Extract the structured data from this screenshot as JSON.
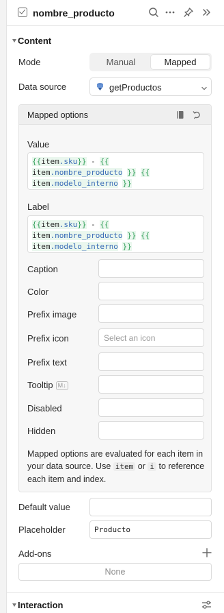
{
  "header": {
    "title": "nombre_producto",
    "icons": [
      "checkbox-icon",
      "search-icon",
      "more-icon",
      "pin-icon",
      "collapse-icon"
    ]
  },
  "content_section": {
    "title": "Content",
    "mode": {
      "label": "Mode",
      "options": [
        "Manual",
        "Mapped"
      ],
      "selected": "Mapped"
    },
    "data_source": {
      "label": "Data source",
      "value": "getProductos"
    },
    "mapped_options": {
      "title": "Mapped options",
      "value": {
        "label": "Value"
      },
      "label": {
        "label": "Label"
      },
      "code": {
        "open": "{{",
        "close": "}}",
        "sep": " - ",
        "item": "item",
        "sku": ".sku",
        "nombre": ".nombre_producto",
        "modelo": ".modelo_interno"
      },
      "fields": {
        "caption": "Caption",
        "color": "Color",
        "prefix_image": "Prefix image",
        "prefix_icon": "Prefix icon",
        "prefix_icon_placeholder": "Select an icon",
        "prefix_text": "Prefix text",
        "tooltip": "Tooltip",
        "tooltip_badge": "M↓",
        "disabled": "Disabled",
        "hidden": "Hidden"
      },
      "help": {
        "part1": "Mapped options are evaluated for each item in your data source. Use",
        "code1": "item",
        "part2": "or",
        "code2": "i",
        "part3": "to reference each item and index."
      }
    },
    "default_value": {
      "label": "Default value",
      "value": ""
    },
    "placeholder": {
      "label": "Placeholder",
      "value": "Producto"
    },
    "addons": {
      "label": "Add-ons",
      "empty": "None"
    }
  },
  "interaction_section": {
    "title": "Interaction"
  }
}
